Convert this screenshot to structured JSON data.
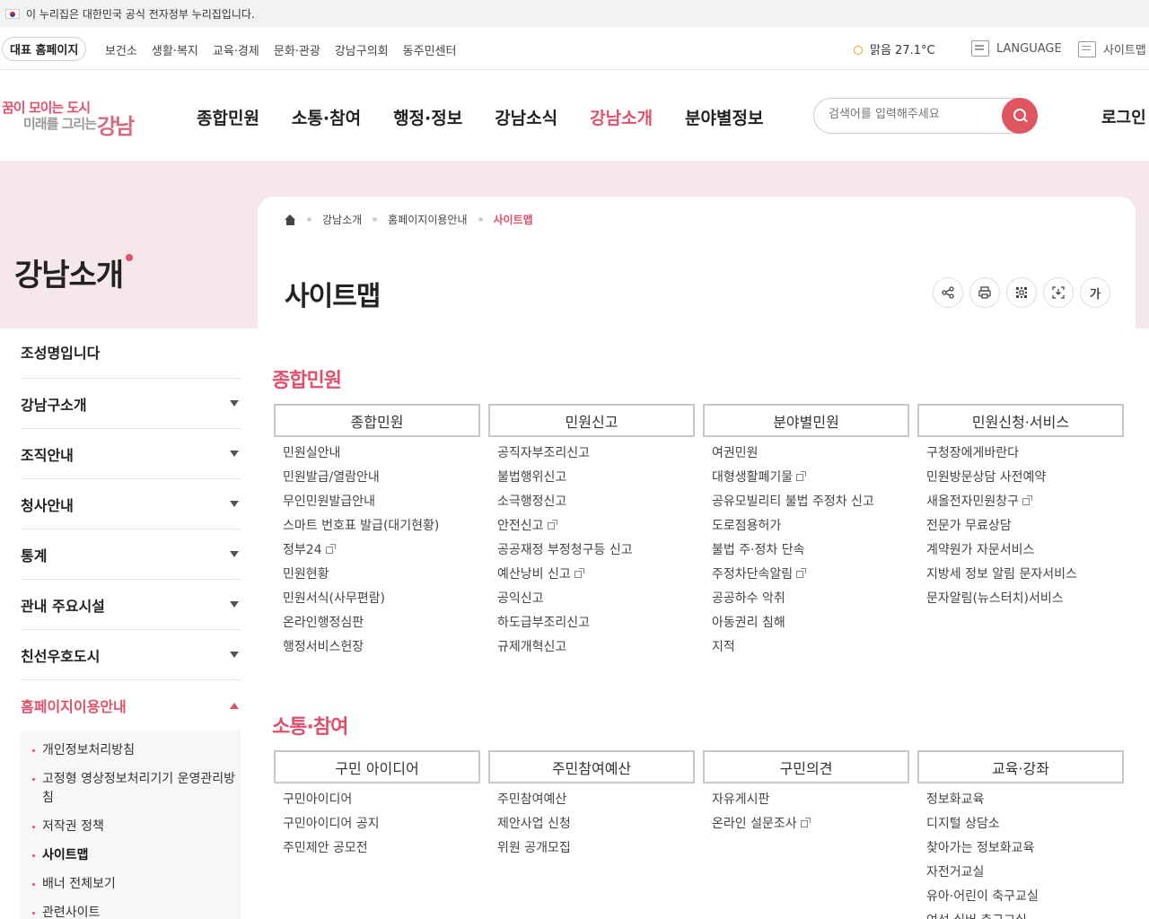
{
  "gov_banner": "이 누리집은 대한민국 공식 전자정부 누리집입니다.",
  "utility": {
    "home": "대표 홈페이지",
    "links": [
      "보건소",
      "생활·복지",
      "교육·경제",
      "문화·관광",
      "강남구의회",
      "동주민센터"
    ],
    "weather": "맑음  27.1°C",
    "language": "LANGUAGE",
    "sitemap": "사이트맵"
  },
  "logo": {
    "line1": "꿈이 모이는 도시",
    "line2": "미래를 그리는",
    "line3": "강남"
  },
  "gnb": [
    "종합민원",
    "소통·참여",
    "행정·정보",
    "강남소식",
    "강남소개",
    "분야별정보"
  ],
  "gnb_active_index": 4,
  "search": {
    "placeholder": "검색어를 입력해주세요"
  },
  "login": "로그인",
  "section_title": "강남소개",
  "breadcrumb": [
    "강남소개",
    "홈페이지이용안내",
    "사이트맵"
  ],
  "page_title": "사이트맵",
  "tools": {
    "font_size": "가"
  },
  "icons": [
    "home-icon",
    "share-icon",
    "print-icon",
    "qr-icon",
    "scrap-icon",
    "font-size-icon",
    "search-icon",
    "sun-icon",
    "external-link-icon"
  ],
  "lnb": {
    "head": "조성명입니다",
    "items": [
      "강남구소개",
      "조직안내",
      "청사안내",
      "통계",
      "관내 주요시설",
      "친선우호도시"
    ],
    "open_item": "홈페이지이용안내",
    "sub_items": [
      "개인정보처리방침",
      "고정형 영상정보처리기기 운영관리방침",
      "저작권 정책",
      "사이트맵",
      "배너 전체보기",
      "관련사이트"
    ],
    "sub_active": "사이트맵"
  },
  "sitemap": [
    {
      "title": "종합민원",
      "columns": [
        {
          "head": "종합민원",
          "items": [
            "민원실안내",
            "민원발급/열람안내",
            "무인민원발급안내",
            "스마트 번호표 발급(대기현황)",
            "정부24",
            "민원현황",
            "민원서식(사무편람)",
            "온라인행정심판",
            "행정서비스헌장"
          ],
          "external": [
            "정부24"
          ]
        },
        {
          "head": "민원신고",
          "items": [
            "공직자부조리신고",
            "불법행위신고",
            "소극행정신고",
            "안전신고",
            "공공재정 부정청구등 신고",
            "예산낭비 신고",
            "공익신고",
            "하도급부조리신고",
            "규제개혁신고"
          ],
          "external": [
            "안전신고",
            "예산낭비 신고"
          ]
        },
        {
          "head": "분야별민원",
          "items": [
            "여권민원",
            "대형생활폐기물",
            "공유모빌리티 불법 주정차 신고",
            "도로점용허가",
            "불법 주·정차 단속",
            "주정차단속알림",
            "공공하수 악취",
            "아동권리 침해",
            "지적"
          ],
          "external": [
            "대형생활폐기물",
            "주정차단속알림"
          ]
        },
        {
          "head": "민원신청·서비스",
          "items": [
            "구청장에게바란다",
            "민원방문상담 사전예약",
            "새올전자민원창구",
            "전문가 무료상담",
            "계약원가 자문서비스",
            "지방세 정보 알림 문자서비스",
            "문자알림(뉴스터치)서비스"
          ],
          "external": [
            "새올전자민원창구"
          ]
        }
      ]
    },
    {
      "title": "소통·참여",
      "columns": [
        {
          "head": "구민 아이디어",
          "items": [
            "구민아이디어",
            "구민아이디어 공지",
            "주민제안 공모전"
          ],
          "external": []
        },
        {
          "head": "주민참여예산",
          "items": [
            "주민참여예산",
            "제안사업 신청",
            "위원 공개모집"
          ],
          "external": []
        },
        {
          "head": "구민의견",
          "items": [
            "자유게시판",
            "온라인 설문조사"
          ],
          "external": [
            "온라인 설문조사"
          ]
        },
        {
          "head": "교육·강좌",
          "items": [
            "정보화교육",
            "디지털 상담소",
            "찾아가는 정보화교육",
            "자전거교실",
            "유아·어린이 축구교실",
            "여성·실버 축구교실"
          ],
          "external": []
        }
      ]
    }
  ]
}
